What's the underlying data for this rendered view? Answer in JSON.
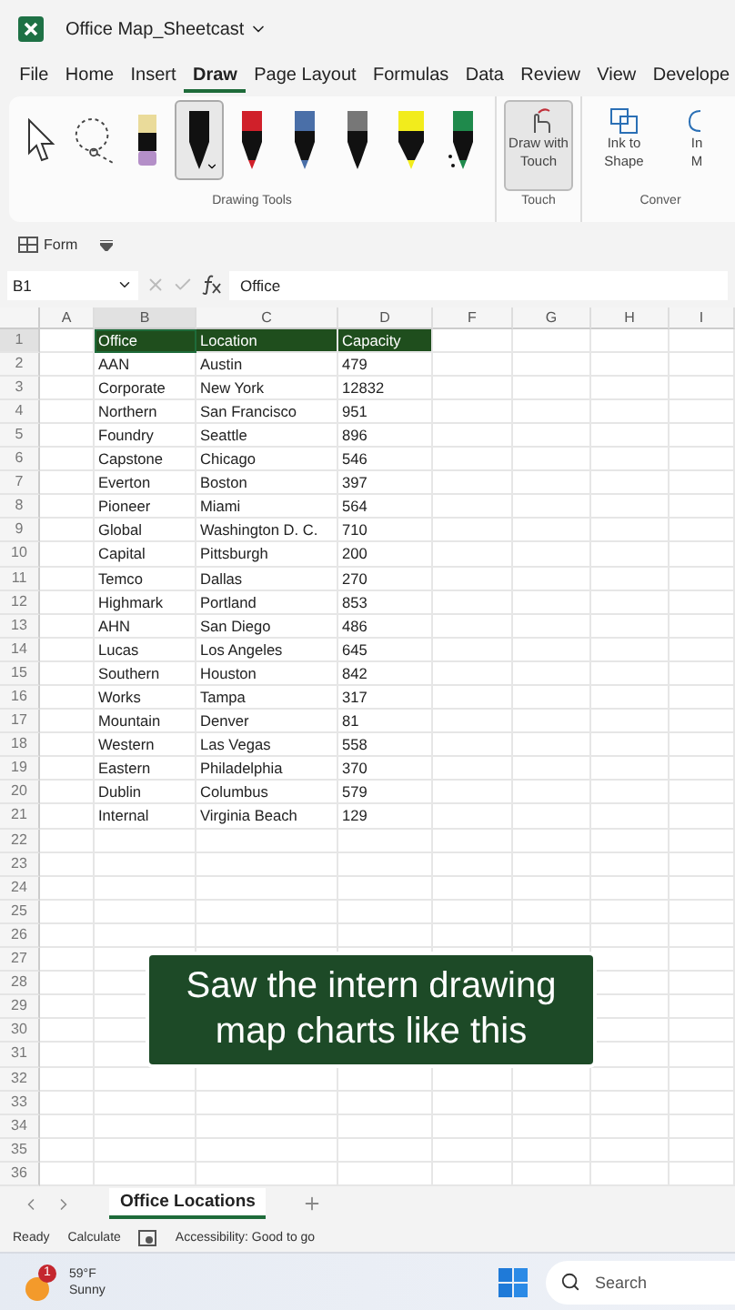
{
  "window": {
    "title": "Office Map_Sheetcast"
  },
  "menu_tabs": [
    {
      "label": "File",
      "selected": false
    },
    {
      "label": "Home",
      "selected": false
    },
    {
      "label": "Insert",
      "selected": false
    },
    {
      "label": "Draw",
      "selected": true
    },
    {
      "label": "Page Layout",
      "selected": false
    },
    {
      "label": "Formulas",
      "selected": false
    },
    {
      "label": "Data",
      "selected": false
    },
    {
      "label": "Review",
      "selected": false
    },
    {
      "label": "View",
      "selected": false
    },
    {
      "label": "Develope",
      "selected": false
    }
  ],
  "ribbon": {
    "tools": [
      {
        "kind": "select",
        "selected": false
      },
      {
        "kind": "lasso",
        "selected": false
      },
      {
        "kind": "eraser",
        "color": "#b48fc8",
        "selected": false
      },
      {
        "kind": "pen",
        "color": "#111111",
        "selected": true
      },
      {
        "kind": "pen",
        "color": "#d0202a",
        "selected": false
      },
      {
        "kind": "pen",
        "color": "#4a6fa8",
        "selected": false
      },
      {
        "kind": "pencil",
        "color": "#777777",
        "selected": false
      },
      {
        "kind": "highlighter",
        "color": "#f2ec1c",
        "selected": false
      },
      {
        "kind": "action",
        "color": "#1f8a4c",
        "selected": false
      }
    ],
    "tools_label": "Drawing Tools",
    "groups": [
      {
        "label": "Touch",
        "buttons": [
          {
            "kind": "touch",
            "lines": [
              "Draw with",
              "Touch"
            ],
            "selected": true
          }
        ]
      },
      {
        "label": "Conver",
        "buttons": [
          {
            "kind": "shape",
            "lines": [
              "Ink to",
              "Shape"
            ],
            "selected": false
          },
          {
            "kind": "math",
            "lines": [
              "In",
              "M"
            ],
            "selected": false
          }
        ]
      }
    ]
  },
  "quick_access": {
    "label": "Form"
  },
  "formula_bar": {
    "name_box": "B1",
    "value": "Office"
  },
  "sheet": {
    "columns": [
      {
        "label": "A",
        "selected": false
      },
      {
        "label": "B",
        "selected": true
      },
      {
        "label": "C",
        "selected": false
      },
      {
        "label": "D",
        "selected": false
      },
      {
        "label": "F",
        "selected": false
      },
      {
        "label": "G",
        "selected": false
      },
      {
        "label": "H",
        "selected": false
      },
      {
        "label": "I",
        "selected": false
      }
    ],
    "row_headers": [
      "1",
      "2",
      "3",
      "4",
      "5",
      "6",
      "7",
      "8",
      "9",
      "10",
      "11",
      "12",
      "13",
      "14",
      "15",
      "16",
      "17",
      "18",
      "19",
      "20",
      "21",
      "22",
      "23",
      "24",
      "25",
      "26",
      "27",
      "28",
      "29",
      "30",
      "31",
      "32",
      "33",
      "34",
      "35",
      "36"
    ],
    "data_table": {
      "header": [
        "Office",
        "Location",
        "Capacity"
      ],
      "rows": [
        [
          "AAN",
          "Austin",
          "479"
        ],
        [
          "Corporate",
          "New York",
          "12832"
        ],
        [
          "Northern",
          "San Francisco",
          "951"
        ],
        [
          "Foundry",
          "Seattle",
          "896"
        ],
        [
          "Capstone",
          "Chicago",
          "546"
        ],
        [
          "Everton",
          "Boston",
          "397"
        ],
        [
          "Pioneer",
          "Miami",
          "564"
        ],
        [
          "Global",
          "Washington D. C.",
          "710"
        ],
        [
          "Capital",
          "Pittsburgh",
          "200"
        ],
        [
          "Temco",
          "Dallas",
          "270"
        ],
        [
          "Highmark",
          "Portland",
          "853"
        ],
        [
          "AHN",
          "San Diego",
          "486"
        ],
        [
          "Lucas",
          "Los Angeles",
          "645"
        ],
        [
          "Southern",
          "Houston",
          "842"
        ],
        [
          "Works",
          "Tampa",
          "317"
        ],
        [
          "Mountain",
          "Denver",
          "81"
        ],
        [
          "Western",
          "Las Vegas",
          "558"
        ],
        [
          "Eastern",
          "Philadelphia",
          "370"
        ],
        [
          "Dublin",
          "Columbus",
          "579"
        ],
        [
          "Internal",
          "Virginia Beach",
          "129"
        ]
      ]
    }
  },
  "caption": {
    "lines": [
      "Saw the intern drawing",
      "map charts like this"
    ]
  },
  "sheet_tabs": [
    {
      "label": "Office Locations",
      "selected": true
    }
  ],
  "status_bar": {
    "items": [
      "Ready",
      "Calculate"
    ],
    "accessibility": "Accessibility: Good to go"
  },
  "taskbar": {
    "weather": {
      "badge": "1",
      "temp": "59°F",
      "condition": "Sunny"
    },
    "search": {
      "placeholder": "Search"
    }
  }
}
